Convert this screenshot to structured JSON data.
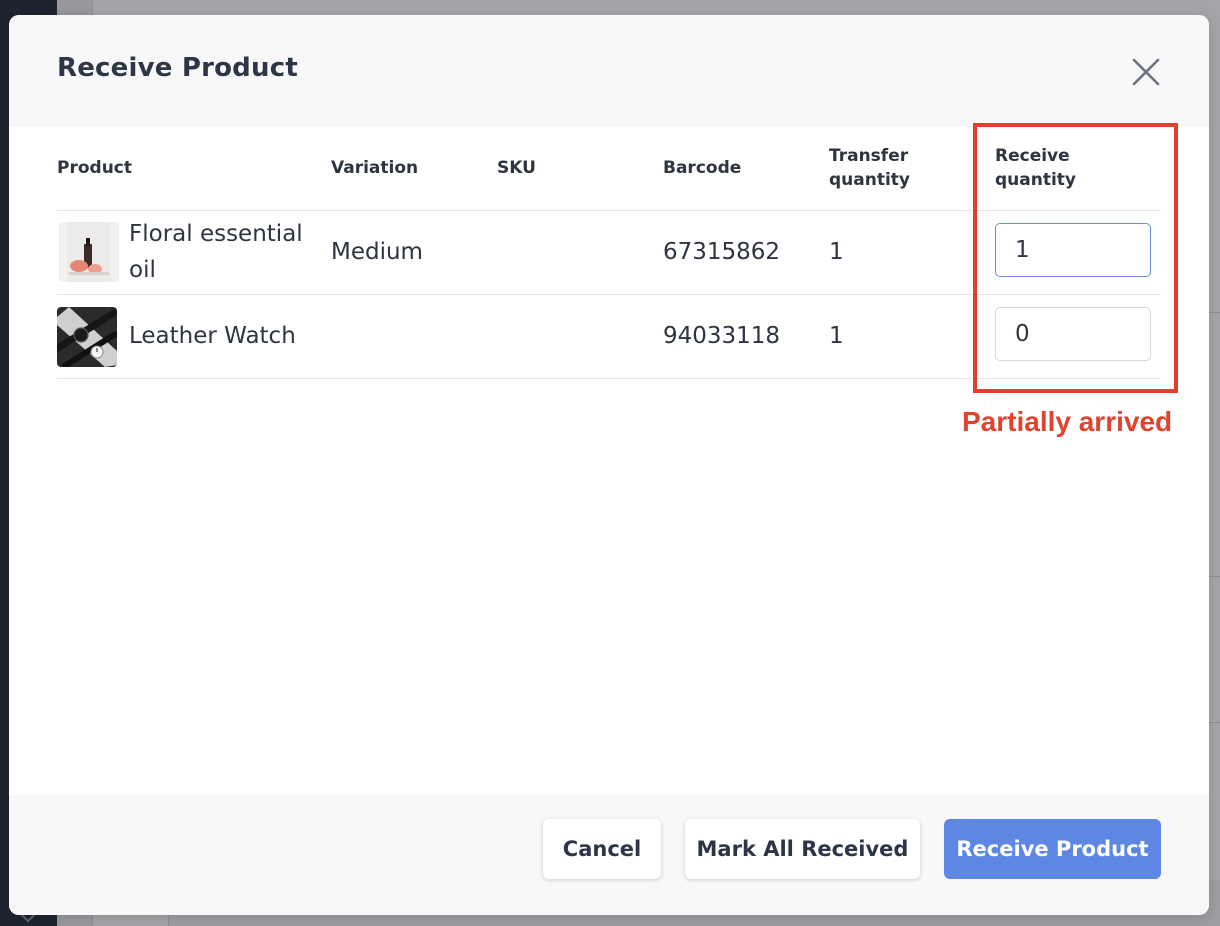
{
  "modal": {
    "title": "Receive Product",
    "close_icon": "close-icon"
  },
  "table": {
    "headers": {
      "product": "Product",
      "variation": "Variation",
      "sku": "SKU",
      "barcode": "Barcode",
      "transfer_line1": "Transfer",
      "transfer_line2": "quantity",
      "receive_line1": "Receive",
      "receive_line2": "quantity"
    },
    "rows": [
      {
        "product_line1": "Floral essential",
        "product_line2": "oil",
        "variation": "Medium",
        "sku": "",
        "barcode": "67315862",
        "transfer_quantity": "1",
        "receive_quantity": "1",
        "thumb_icon": "essential-oil-thumbnail"
      },
      {
        "product_line1": "Leather Watch",
        "variation": "",
        "sku": "",
        "barcode": "94033118",
        "transfer_quantity": "1",
        "receive_quantity": "0",
        "thumb_icon": "leather-watch-thumbnail"
      }
    ]
  },
  "annotation": {
    "text": "Partially arrived",
    "color": "#e0402d"
  },
  "footer": {
    "cancel_label": "Cancel",
    "mark_all_label": "Mark All Received",
    "receive_label": "Receive Product"
  },
  "colors": {
    "primary": "#5d87e3",
    "focus_border": "#6c8ee0"
  }
}
